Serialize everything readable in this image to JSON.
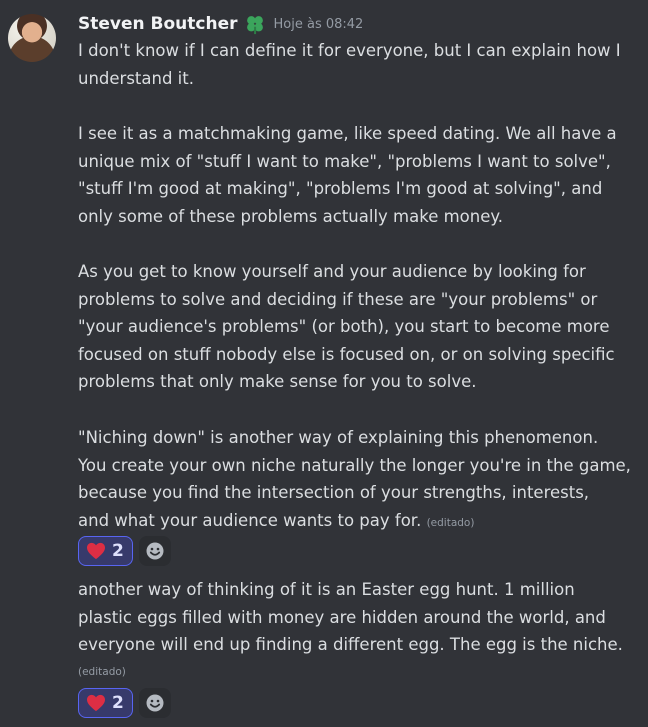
{
  "message": {
    "author": "Steven Boutcher",
    "timestamp": "Hoje às 08:42",
    "paragraphs": [
      "I don't know if I can define it for everyone, but I can explain how I\nunderstand it.",
      "I see it as a matchmaking game, like speed dating. We all have a\nunique mix of \"stuff I want to make\", \"problems I want to solve\",\n\"stuff I'm good at making\", \"problems I'm good at solving\", and\nonly some of these problems actually make money.",
      "As you get to know yourself and your audience by looking for\nproblems to solve and deciding if these are \"your problems\" or\n\"your audience's problems\" (or both), you start to become more\nfocused on stuff nobody else is focused on, or on solving specific\nproblems that only make sense for you to solve.",
      "\"Niching down\" is another way of explaining this phenomenon.\nYou create your own niche naturally the longer you're in the game,\nbecause you find the intersection of your strengths, interests,\nand what your audience wants to pay for."
    ],
    "edited_label": "(editado)",
    "reaction": {
      "emoji": "heart",
      "count": "2"
    }
  },
  "reply": {
    "text": "another way of thinking of it is an Easter egg hunt. 1 million\nplastic eggs filled with money are hidden around the world, and\neveryone will end up finding a different egg. The egg is the niche.",
    "edited_label": "(editado)",
    "reaction": {
      "emoji": "heart",
      "count": "2"
    }
  },
  "colors": {
    "background": "#313338",
    "reaction_accent": "#5865f2",
    "badge": "#3ba55c"
  }
}
